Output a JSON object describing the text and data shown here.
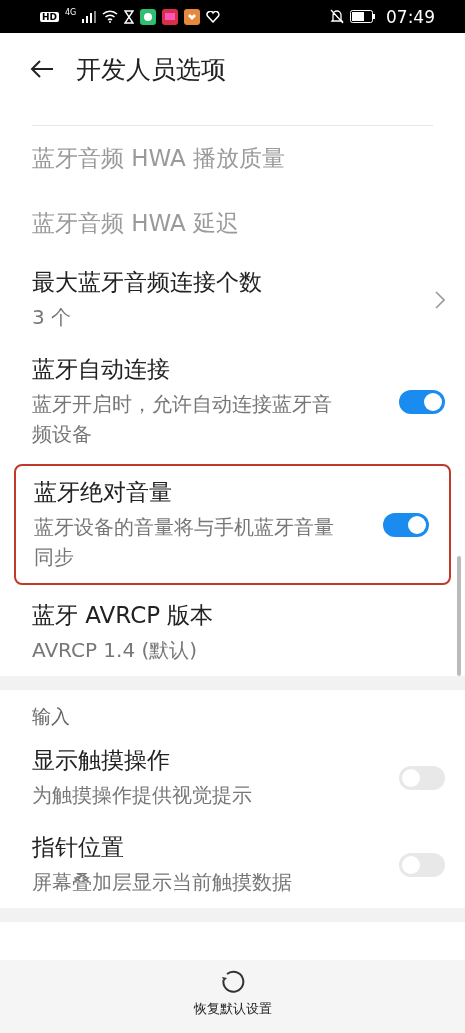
{
  "status_bar": {
    "hd": "HD",
    "network": "4G",
    "time": "07:49"
  },
  "header": {
    "title": "开发人员选项"
  },
  "items": [
    {
      "kind": "plain",
      "title": "蓝牙音频 HWA 播放质量",
      "disabled": true,
      "highlighted": false
    },
    {
      "kind": "plain",
      "title": "蓝牙音频 HWA 延迟",
      "disabled": true,
      "highlighted": false
    },
    {
      "kind": "chevron",
      "title": "最大蓝牙音频连接个数",
      "subtitle": "3 个",
      "disabled": false,
      "highlighted": false
    },
    {
      "kind": "toggle",
      "title": "蓝牙自动连接",
      "subtitle": "蓝牙开启时，允许自动连接蓝牙音频设备",
      "on": true,
      "disabled": false,
      "highlighted": false
    },
    {
      "kind": "toggle",
      "title": "蓝牙绝对音量",
      "subtitle": "蓝牙设备的音量将与手机蓝牙音量同步",
      "on": true,
      "disabled": false,
      "highlighted": true
    },
    {
      "kind": "plain",
      "title": "蓝牙 AVRCP 版本",
      "subtitle": "AVRCP 1.4 (默认)",
      "disabled": false,
      "highlighted": false
    },
    {
      "kind": "gap"
    },
    {
      "kind": "section",
      "title": "输入"
    },
    {
      "kind": "toggle",
      "title": "显示触摸操作",
      "subtitle": "为触摸操作提供视觉提示",
      "on": false,
      "disabled": false,
      "highlighted": false
    },
    {
      "kind": "toggle",
      "title": "指针位置",
      "subtitle": "屏幕叠加层显示当前触摸数据",
      "on": false,
      "disabled": false,
      "highlighted": false
    },
    {
      "kind": "gap"
    }
  ],
  "bottom_action": {
    "label": "恢复默认设置"
  }
}
